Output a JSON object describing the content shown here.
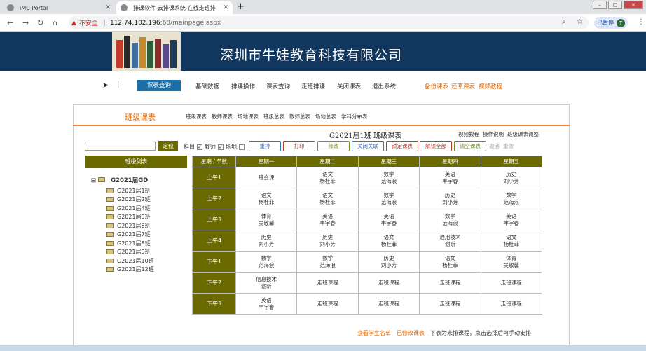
{
  "browser": {
    "tabs": [
      {
        "title": "iMC Portal"
      },
      {
        "title": "排课软件-云排课系统-在线走班排"
      }
    ],
    "new_tab": "+",
    "security_warning": "不安全",
    "url_host": "112.74.102.196",
    "url_path": ":68/mainpage.aspx",
    "profile_status": "已暂停",
    "profile_initial": "T"
  },
  "banner": {
    "company": "深圳市牛娃教育科技有限公司"
  },
  "menu": {
    "bar": "|",
    "active": "课表查询",
    "items": [
      "基础数据",
      "排课操作",
      "课表查询",
      "走班排课",
      "关闭课表",
      "退出系统"
    ],
    "extras": [
      "备份课表",
      "还原课表",
      "视频教程"
    ]
  },
  "panel": {
    "title": "班级课表",
    "subtabs": [
      "班级课表",
      "教师课表",
      "场地课表",
      "班级总表",
      "教师总表",
      "场地总表",
      "学科分布表"
    ],
    "table_title": "G2021届1班  班级课表",
    "top_links": [
      "视频教程",
      "操作说明",
      "班级课表调整"
    ]
  },
  "controls": {
    "locate": "定位",
    "checkboxes": [
      {
        "label": "科目",
        "checked": true
      },
      {
        "label": "教师",
        "checked": true
      },
      {
        "label": "场地",
        "checked": false
      }
    ],
    "buttons": [
      {
        "label": "重排",
        "color": "#3d6fb6"
      },
      {
        "label": "打印",
        "color": "#c0392b"
      },
      {
        "label": "修改",
        "color": "#8a8a1c"
      },
      {
        "label": "关闭关联",
        "color": "#3d6fb6"
      },
      {
        "label": "锁定课表",
        "color": "#c0392b"
      },
      {
        "label": "解锁全部",
        "color": "#c0392b"
      },
      {
        "label": "清空课表",
        "color": "#6b8e23"
      }
    ],
    "disabled": [
      "撤消",
      "重做"
    ]
  },
  "sidebar": {
    "heading": "班级列表",
    "root": "G2021届GD",
    "classes": [
      "G2021届1班",
      "G2021届2班",
      "G2021届4班",
      "G2021届5班",
      "G2021届6班",
      "G2021届7班",
      "G2021届8班",
      "G2021届9班",
      "G2021届10班",
      "G2021届12班"
    ]
  },
  "schedule": {
    "headers": [
      "星期 / 节数",
      "星期一",
      "星期二",
      "星期三",
      "星期四",
      "星期五"
    ],
    "rows": [
      {
        "period": "上午1",
        "cells": [
          [
            "班会课",
            ""
          ],
          [
            "语文",
            "杨杜菲"
          ],
          [
            "数学",
            "范海浪"
          ],
          [
            "英语",
            "丰宇春"
          ],
          [
            "历史",
            "刘小芳"
          ]
        ]
      },
      {
        "period": "上午2",
        "cells": [
          [
            "语文",
            "杨杜菲"
          ],
          [
            "语文",
            "杨杜菲"
          ],
          [
            "数学",
            "范海浪"
          ],
          [
            "历史",
            "刘小芳"
          ],
          [
            "数学",
            "范海浪"
          ]
        ]
      },
      {
        "period": "上午3",
        "cells": [
          [
            "体育",
            "吴敬馨"
          ],
          [
            "英语",
            "丰宇春"
          ],
          [
            "英语",
            "丰宇春"
          ],
          [
            "数学",
            "范海浪"
          ],
          [
            "英语",
            "丰宇春"
          ]
        ]
      },
      {
        "period": "上午4",
        "cells": [
          [
            "历史",
            "刘小芳"
          ],
          [
            "历史",
            "刘小芳"
          ],
          [
            "语文",
            "杨杜菲"
          ],
          [
            "通用技术",
            "谢昕"
          ],
          [
            "语文",
            "杨杜菲"
          ]
        ]
      },
      {
        "period": "下午1",
        "cells": [
          [
            "数学",
            "范海浪"
          ],
          [
            "数学",
            "范海浪"
          ],
          [
            "历史",
            "刘小芳"
          ],
          [
            "语文",
            "杨杜菲"
          ],
          [
            "体育",
            "吴敬馨"
          ]
        ]
      },
      {
        "period": "下午2",
        "cells": [
          [
            "信息技术",
            "谢昕"
          ],
          [
            "走班课程",
            ""
          ],
          [
            "走班课程",
            ""
          ],
          [
            "走班课程",
            ""
          ],
          [
            "走班课程",
            ""
          ]
        ]
      },
      {
        "period": "下午3",
        "cells": [
          [
            "英语",
            "丰宇春"
          ],
          [
            "走班课程",
            ""
          ],
          [
            "走班课程",
            ""
          ],
          [
            "走班课程",
            ""
          ],
          [
            "走班课程",
            ""
          ]
        ]
      }
    ]
  },
  "footer": {
    "links": [
      "查看学生名单",
      "已修改课表"
    ],
    "note": "下表为未排课程，点击选择后可手动安排"
  }
}
